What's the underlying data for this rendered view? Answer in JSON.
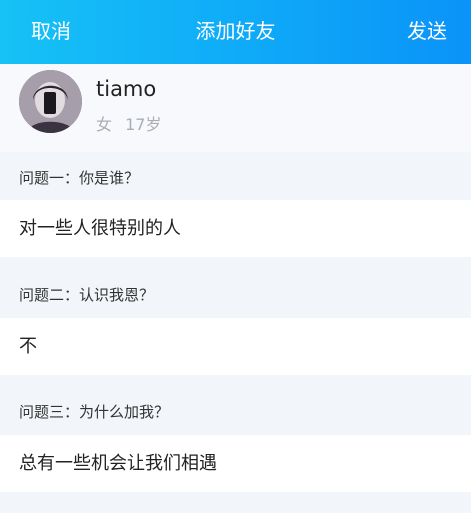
{
  "header": {
    "cancel_label": "取消",
    "title": "添加好友",
    "send_label": "发送",
    "gradient_start": "#16c2f6",
    "gradient_end": "#0a93f8"
  },
  "profile": {
    "nickname": "tiamo",
    "gender": "女",
    "age": "17岁"
  },
  "questions": [
    {
      "label": "问题一：你是谁？",
      "answer": "对一些人很特别的人"
    },
    {
      "label": "问题二：认识我恩？",
      "answer": "不"
    },
    {
      "label": "问题三：为什么加我？",
      "answer": "总有一些机会让我们相遇"
    }
  ]
}
